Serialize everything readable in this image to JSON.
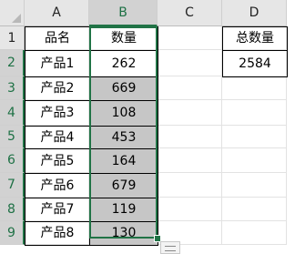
{
  "columns": [
    "A",
    "B",
    "C",
    "D"
  ],
  "rows": [
    "1",
    "2",
    "3",
    "4",
    "5",
    "6",
    "7",
    "8",
    "9"
  ],
  "headers": {
    "product_name": "品名",
    "quantity": "数量"
  },
  "products": [
    "产品1",
    "产品2",
    "产品3",
    "产品4",
    "产品5",
    "产品6",
    "产品7",
    "产品8"
  ],
  "quantities": [
    "262",
    "669",
    "108",
    "453",
    "164",
    "679",
    "119",
    "130"
  ],
  "summary": {
    "label": "总数量",
    "value": "2584"
  },
  "selection": {
    "range": "B2:B9"
  },
  "colors": {
    "selection_accent": "#217346",
    "selected_fill": "#c6c6c6"
  }
}
